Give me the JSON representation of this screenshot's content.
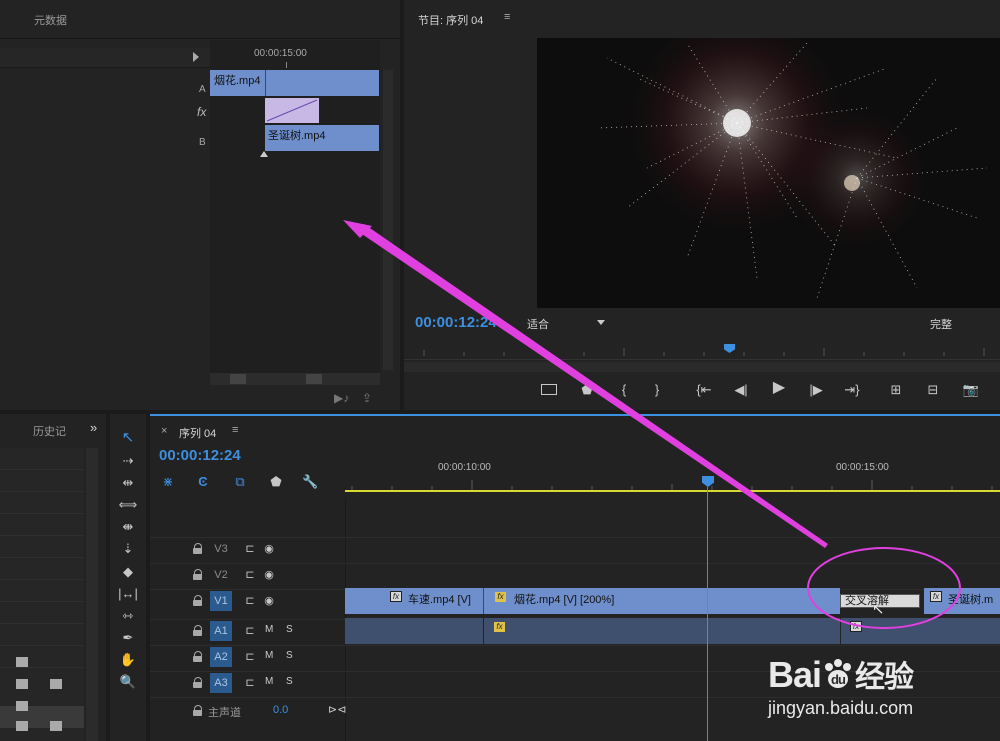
{
  "effect_controls": {
    "tab_metadata": "元数据",
    "timecode": "00:00:15:00",
    "clip_a_label": "A",
    "clip_a_name": "烟花.mp4",
    "fx_label": "fx",
    "clip_b_label": "B",
    "clip_b_name": "圣诞树.mp4"
  },
  "program_monitor": {
    "title": "节目: 序列 04",
    "timecode": "00:00:12:24",
    "fit_label": "适合",
    "quality_label": "完整"
  },
  "history_panel": {
    "tab_label": "历史记",
    "expand_icon": "»"
  },
  "sequence": {
    "close": "×",
    "tab_label": "序列 04",
    "timecode": "00:00:12:24",
    "ruler_ticks": [
      "00:00:10:00",
      "00:00:15:00"
    ],
    "tracks": [
      {
        "name": "V3",
        "m": "",
        "s": ""
      },
      {
        "name": "V2",
        "m": "",
        "s": ""
      },
      {
        "name": "V1",
        "m": "",
        "s": ""
      },
      {
        "name": "A1",
        "m": "M",
        "s": "S"
      },
      {
        "name": "A2",
        "m": "M",
        "s": "S"
      },
      {
        "name": "A3",
        "m": "M",
        "s": "S"
      }
    ],
    "master_label": "主声道",
    "master_value": "0.0",
    "clip1": "车速.mp4 [V]",
    "clip2": "烟花.mp4 [V] [200%]",
    "transition": "交叉溶解",
    "clip3": "圣诞树.m",
    "fx": "fx"
  },
  "watermark": {
    "brand": "Bai",
    "brand2": "du",
    "brand_cn": "经验",
    "url": "jingyan.baidu.com"
  },
  "colors": {
    "accent_blue": "#3d8fe0",
    "clip_blue": "#6e8fcc",
    "annotation_magenta": "#e040e0",
    "work_area_yellow": "#d8d830"
  }
}
